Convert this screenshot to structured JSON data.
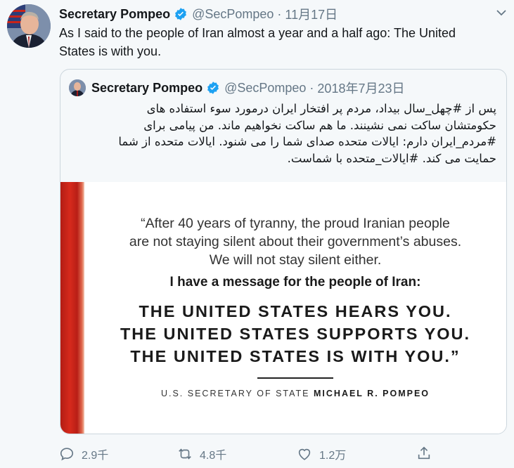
{
  "tweet": {
    "author_name": "Secretary Pompeo",
    "handle": "@SecPompeo",
    "separator": "·",
    "date": "11月17日",
    "text_line1": "As I said to the people of Iran almost a year and a half ago: The United",
    "text_line2": "States is with you."
  },
  "quoted": {
    "author_name": "Secretary Pompeo",
    "handle": "@SecPompeo",
    "separator": "·",
    "date": "2018年7月23日",
    "text_line1": "پس از #چهل_سال بیداد، مردم پر افتخار ایران درمورد سوء استفاده های",
    "text_line2": "حکومتشان ساکت نمی نشینند. ما هم ساکت نخواهیم ماند. من پیامی برای",
    "text_line3": "#مردم_ایران دارم: ایالات متحده صدای شما را می شنود. ایالات متحده از شما",
    "text_line4": "حمایت می کند. #ایالات_متحده با شماست.",
    "image": {
      "quote1": "“After 40 years of tyranny, the proud Iranian people",
      "quote2": "are not staying silent about their government’s abuses.",
      "quote3": "We will not stay silent either.",
      "message": "I have a message for the people of Iran:",
      "caps1": "THE UNITED STATES HEARS YOU.",
      "caps2": "THE UNITED STATES SUPPORTS YOU.",
      "caps3": "THE UNITED STATES IS WITH YOU.”",
      "attrib_prefix": "U.S. SECRETARY OF STATE",
      "attrib_name": "MICHAEL R. POMPEO"
    }
  },
  "actions": {
    "reply_count": "2.9千",
    "retweet_count": "4.8千",
    "like_count": "1.2万"
  },
  "icons": {
    "verified": "verified-badge-icon",
    "more": "chevron-down-icon",
    "reply": "reply-icon",
    "retweet": "retweet-icon",
    "like": "heart-icon",
    "share": "share-icon"
  },
  "colors": {
    "verified_blue": "#1da1f2",
    "muted_text": "#657786",
    "background": "#f5f8fa",
    "accent_red": "#c8241a"
  }
}
